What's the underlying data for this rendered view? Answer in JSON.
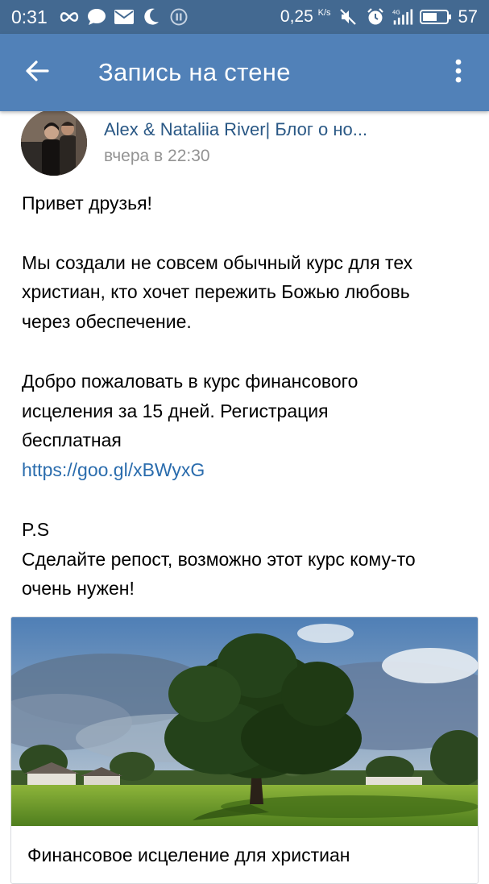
{
  "status_bar": {
    "time": "0:31",
    "speed": "0,25",
    "speed_unit": "K/s",
    "battery": "57",
    "icons": [
      "infinity-icon",
      "chat-bubble-icon",
      "mail-icon",
      "moon-icon",
      "pause-icon",
      "mute-icon",
      "alarm-icon",
      "signal-4g-icon",
      "battery-icon"
    ]
  },
  "app_bar": {
    "title": "Запись на стене",
    "back_icon": "arrow-left-icon",
    "menu_icon": "more-vertical-icon"
  },
  "post": {
    "author": "Alex &  Nataliia River| Блог о но...",
    "time": "вчера в 22:30",
    "paragraphs": {
      "greeting": "Привет друзья!",
      "intro_1": "Мы создали не совсем обычный курс для тех",
      "intro_2": "христиан, кто хочет пережить Божью любовь",
      "intro_3": "через обеспечение.",
      "welcome_1": "Добро пожаловать в курс финансового",
      "welcome_2": "исцеления за 15 дней. Регистрация",
      "welcome_3": "бесплатная",
      "link": "https://goo.gl/xBWyxG",
      "ps": "P.S",
      "repost_1": "Сделайте репост, возможно этот курс кому-то",
      "repost_2": "очень нужен!"
    }
  },
  "link_card": {
    "title": "Финансовое исцеление для христиан"
  },
  "colors": {
    "status_bar": "#436991",
    "app_bar": "#5181b8",
    "author_link": "#2a5885",
    "url_link": "#2a6cad",
    "meta_text": "#939393"
  }
}
